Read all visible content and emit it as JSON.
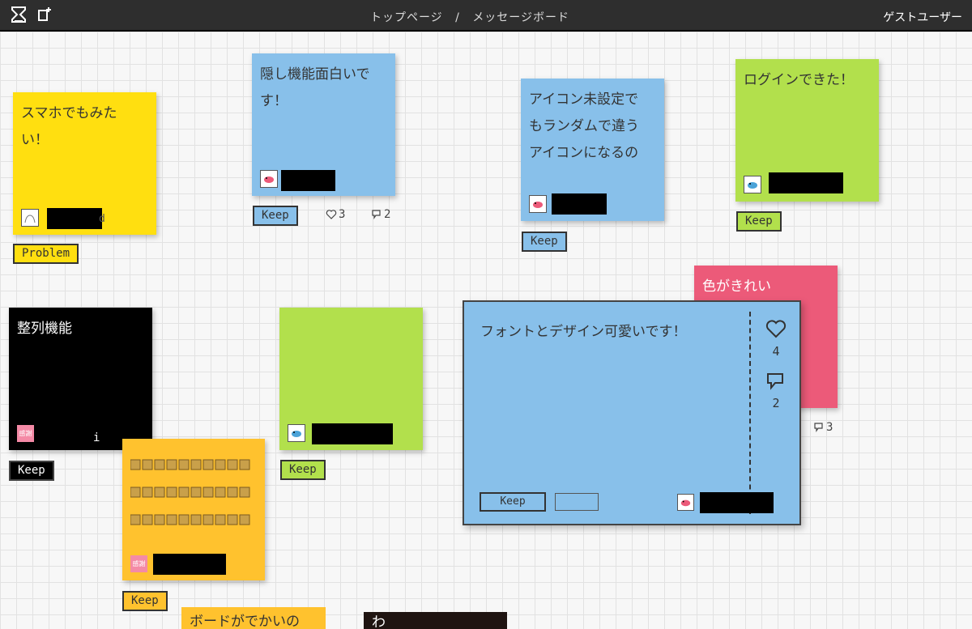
{
  "header": {
    "breadcrumb_home": "トップページ",
    "breadcrumb_sep": "/",
    "breadcrumb_current": "メッセージボード",
    "user_label": "ゲストユーザー"
  },
  "notes": {
    "n1": {
      "text": "スマホでもみた\nい！",
      "tag": "Problem",
      "name_visible_tail": "d"
    },
    "n2": {
      "text": "隠し機能面白いで\nす！",
      "tag": "Keep",
      "likes": "3",
      "comments": "2"
    },
    "n3": {
      "text": "アイコン未設定で\nもランダムで違う\nアイコンになるの",
      "tag": "Keep"
    },
    "n4": {
      "text": "ログインできた！",
      "tag": "Keep"
    },
    "n5": {
      "text": "色がきれい",
      "comments": "3"
    },
    "n6": {
      "text": "整列機能",
      "tag": "Keep",
      "name_visible_tail": "i",
      "avatar_label": "感謝"
    },
    "n7": {
      "text": "",
      "tag": "Keep"
    },
    "n8": {
      "tag": "Keep",
      "avatar_label": "感謝"
    },
    "n9": {
      "text": "ボードがでかいの"
    },
    "n10": {
      "text": "わ"
    }
  },
  "detail": {
    "text": "フォントとデザイン可愛いです！",
    "likes": "4",
    "comments": "2",
    "keep_label": "Keep"
  },
  "colors": {
    "yellow": "#ffdf10",
    "blue": "#88c0ea",
    "green": "#b2e04c",
    "pink": "#ec5a79",
    "black": "#000000",
    "orange": "#ffc22e",
    "topbar": "#2e2e2e"
  },
  "icons": [
    "hourglass-icon",
    "new-note-icon",
    "heart-icon",
    "comment-icon",
    "bird-avatar-icon"
  ]
}
